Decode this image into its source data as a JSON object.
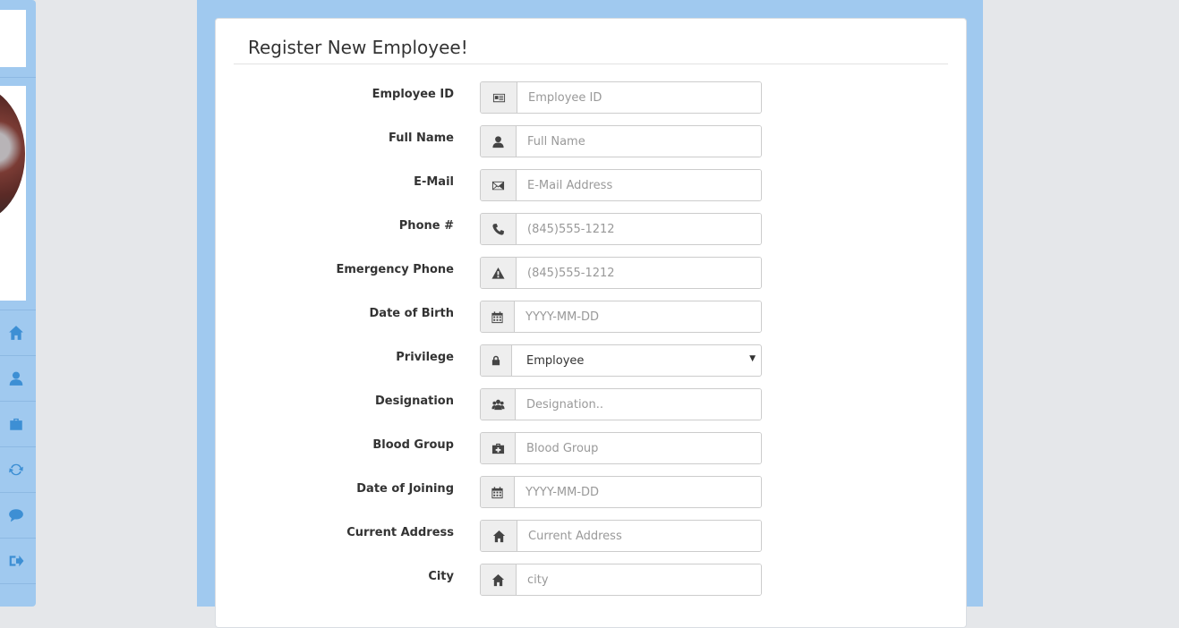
{
  "sidebar": {
    "nav": [
      {
        "icon": "home-icon"
      },
      {
        "icon": "user-icon"
      },
      {
        "icon": "briefcase-icon"
      },
      {
        "icon": "refresh-icon"
      },
      {
        "icon": "comment-icon"
      },
      {
        "icon": "logout-icon"
      }
    ]
  },
  "form": {
    "title": "Register New Employee!",
    "fields": [
      {
        "label": "Employee ID",
        "placeholder": "Employee ID",
        "icon": "id-card-icon"
      },
      {
        "label": "Full Name",
        "placeholder": "Full Name",
        "icon": "user-icon"
      },
      {
        "label": "E-Mail",
        "placeholder": "E-Mail Address",
        "icon": "envelope-icon"
      },
      {
        "label": "Phone #",
        "placeholder": "(845)555-1212",
        "icon": "phone-icon"
      },
      {
        "label": "Emergency Phone",
        "placeholder": "(845)555-1212",
        "icon": "warning-icon"
      },
      {
        "label": "Date of Birth",
        "placeholder": "YYYY-MM-DD",
        "icon": "calendar-icon"
      },
      {
        "label": "Privilege",
        "value": "Employee",
        "icon": "lock-icon"
      },
      {
        "label": "Designation",
        "placeholder": "Designation..",
        "icon": "users-icon"
      },
      {
        "label": "Blood Group",
        "placeholder": "Blood Group",
        "icon": "medkit-icon"
      },
      {
        "label": "Date of Joining",
        "placeholder": "YYYY-MM-DD",
        "icon": "calendar-icon"
      },
      {
        "label": "Current Address",
        "placeholder": "Current Address",
        "icon": "home-icon"
      },
      {
        "label": "City",
        "placeholder": "city",
        "icon": "home-icon"
      }
    ]
  }
}
